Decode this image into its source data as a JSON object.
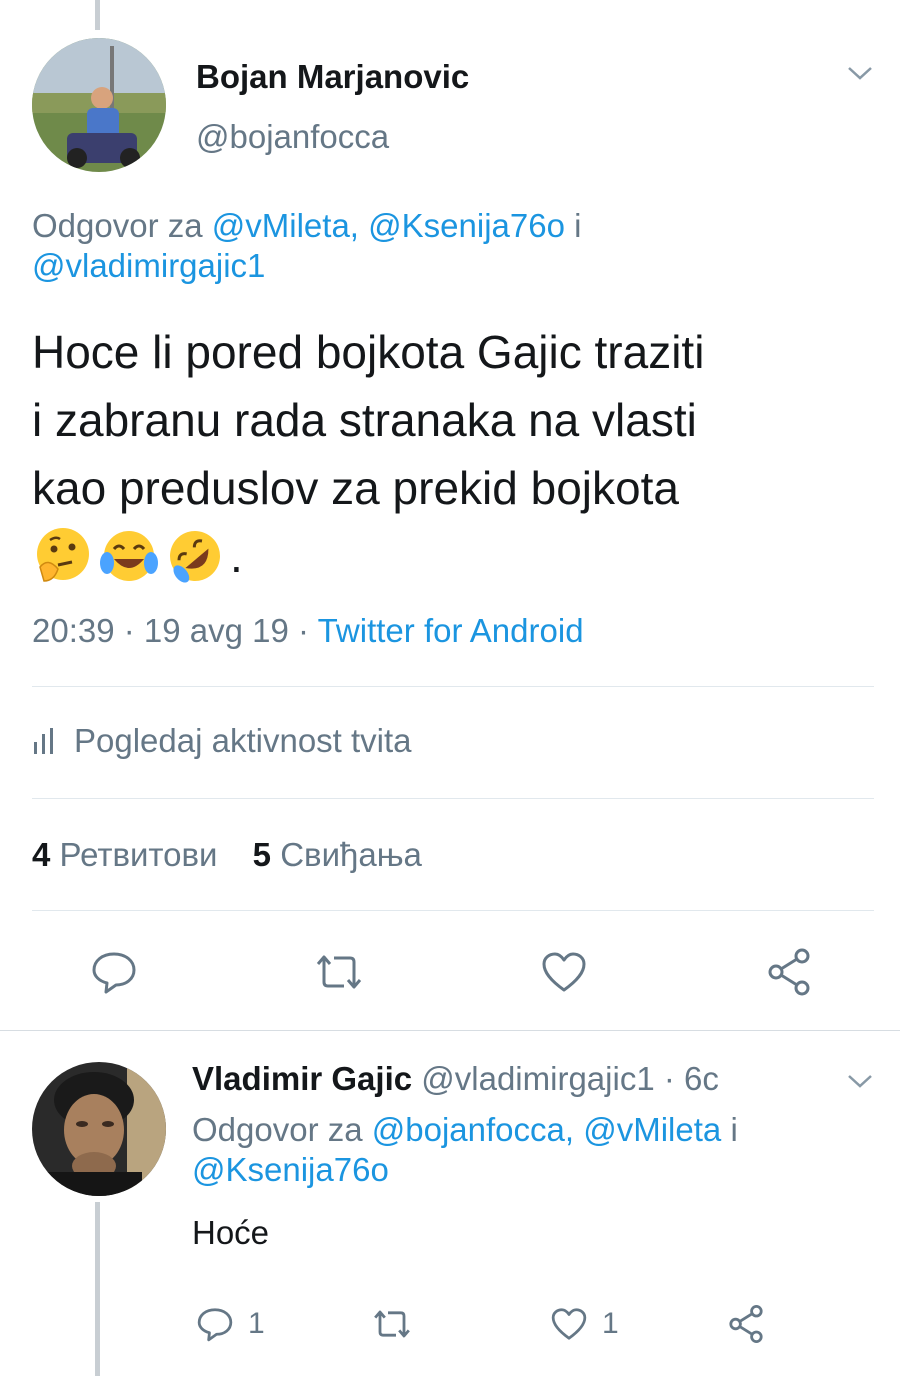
{
  "tweet": {
    "author": {
      "name": "Bojan Marjanovic",
      "handle": "@bojanfocca"
    },
    "reply_prefix": "Odgovor za",
    "reply_mentions": [
      "@vMileta,",
      "@Ksenija76o",
      "@vladimirgajic1"
    ],
    "reply_and": "i",
    "text_lines": [
      "Hoce li pored bojkota Gajic traziti",
      "i zabranu rada stranaka na vlasti",
      "kao preduslov za prekid bojkota"
    ],
    "emojis": [
      "thinking-face-icon",
      "tears-of-joy-icon",
      "rolling-laughing-icon"
    ],
    "text_end": ".",
    "time": "20:39 · 19 avg 19 · ",
    "source": "Twitter for Android",
    "activity_label": "Pogledaj aktivnost tvita",
    "retweets_count": "4",
    "retweets_label": "Ретвитови",
    "likes_count": "5",
    "likes_label": "Свиђања"
  },
  "reply": {
    "author": {
      "name": "Vladimir Gajic",
      "handle": "@vladimirgajic1 · 6c"
    },
    "reply_prefix": "Odgovor za",
    "reply_mentions": [
      "@bojanfocca,",
      "@vMileta",
      "@Ksenija76o"
    ],
    "reply_and": "i",
    "text": "Hoće",
    "reply_count": "1",
    "like_count": "1"
  },
  "colors": {
    "link": "#1b95e0",
    "secondary": "#657786",
    "divider": "#e1e8ed"
  }
}
